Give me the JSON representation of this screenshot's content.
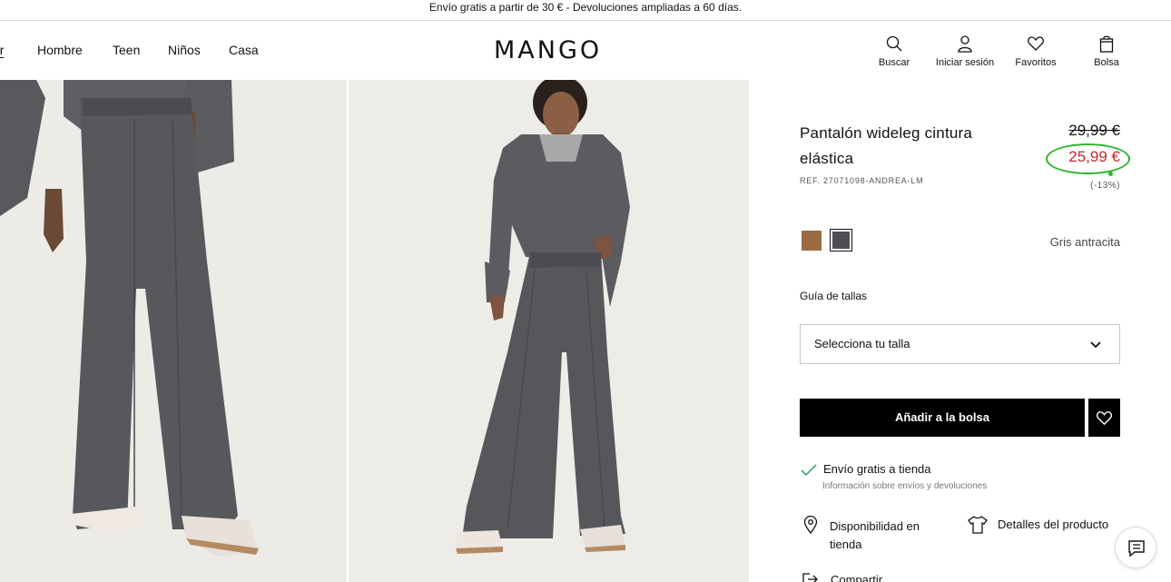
{
  "promo": {
    "text": "Envío gratis a partir de 30 € - Devoluciones ampliadas a 60 días."
  },
  "nav": {
    "items": [
      {
        "label": "er"
      },
      {
        "label": "Hombre"
      },
      {
        "label": "Teen"
      },
      {
        "label": "Niños"
      },
      {
        "label": "Casa"
      }
    ]
  },
  "logo": {
    "text": "MANGO"
  },
  "header_actions": {
    "search": {
      "label": "Buscar",
      "icon": "search-icon"
    },
    "login": {
      "label": "Iniciar sesión",
      "icon": "user-icon"
    },
    "favorites": {
      "label": "Favoritos",
      "icon": "heart-icon"
    },
    "bag": {
      "label": "Bolsa",
      "icon": "bag-icon"
    }
  },
  "product": {
    "name": "Pantalón wideleg cintura elástica",
    "ref": "REF. 27071098-ANDREA-LM",
    "price_old": "29,99 €",
    "price_new": "25,99 €",
    "discount": "(-13%)",
    "color_name": "Gris antracita",
    "swatches": [
      {
        "color": "#9b6b44",
        "selected": false
      },
      {
        "color": "#4d4f52",
        "selected": true
      }
    ]
  },
  "size": {
    "guide_label": "Guía de tallas",
    "placeholder": "Selecciona tu talla"
  },
  "actions": {
    "add_label": "Añadir a la bolsa"
  },
  "shipping": {
    "title": "Envío gratis a tienda",
    "subtitle": "Información sobre envíos y devoluciones"
  },
  "info_links": {
    "availability": "Disponibilidad en tienda",
    "details": "Detalles del producto",
    "share": "Compartir"
  },
  "colors": {
    "price_sale": "#c0282d",
    "highlight_circle": "#2db52d",
    "button_bg": "#000000"
  }
}
